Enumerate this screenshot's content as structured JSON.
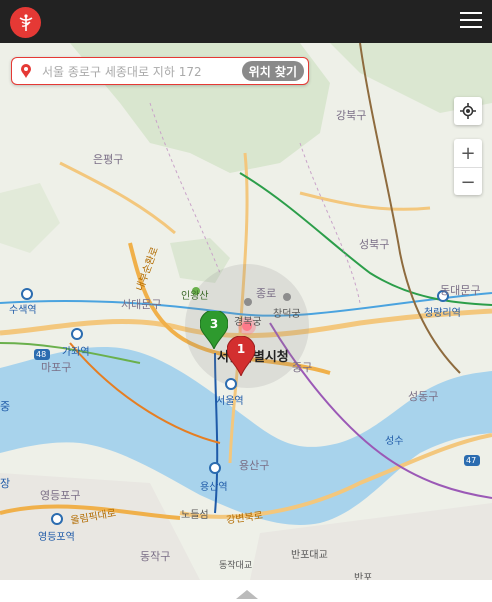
{
  "header": {
    "logo_icon": "caduceus-icon",
    "menu_icon": "hamburger-menu-icon"
  },
  "search": {
    "placeholder": "서울 종로구 세종대로 지하 172",
    "button_label": "위치 찾기"
  },
  "controls": {
    "locate_icon": "my-location-icon",
    "zoom_in": "+",
    "zoom_out": "−"
  },
  "map_labels": {
    "gangbukgu": "강북구",
    "eunpyeonggu": "은평구",
    "seongbukgu": "성북구",
    "dongdaemungu": "동대문구",
    "seodaemungu": "서대문구",
    "mapogu": "마포구",
    "jongno": "종로",
    "junggu": "중구",
    "seongdonggu": "성동구",
    "yongsangu": "용산구",
    "yeongdeungpogu": "영등포구",
    "dongjakgu": "동작구",
    "seoul_city_hall": "서울특별시청",
    "inwangsan": "인왕산",
    "gyeongbokgung": "경복궁",
    "changdeokgung": "창덕궁",
    "suseok_station": "수색역",
    "gajwa_station": "가좌역",
    "seoul_station": "서울역",
    "cheongnyangni_station": "청량리역",
    "yongsan_station": "용산역",
    "noryangjin": "노들섬",
    "yeongdeungpo_station": "영등포역",
    "seongsu": "성수",
    "banpo_bridge": "반포대교",
    "banpo": "반포",
    "dongjak_bridge": "동작대교",
    "gangbyeon_road": "강변북로",
    "olympic_road": "올림픽대로",
    "naebu_road": "내부순환로",
    "route_48": "48",
    "route_47": "47",
    "left_edge_1": "중",
    "left_edge_2": "장"
  },
  "markers": [
    {
      "label": "1",
      "color": "#d32f2f"
    },
    {
      "label": "3",
      "color": "#2e9a2e"
    }
  ],
  "footer": {
    "toggle_icon": "chevron-up-icon"
  }
}
